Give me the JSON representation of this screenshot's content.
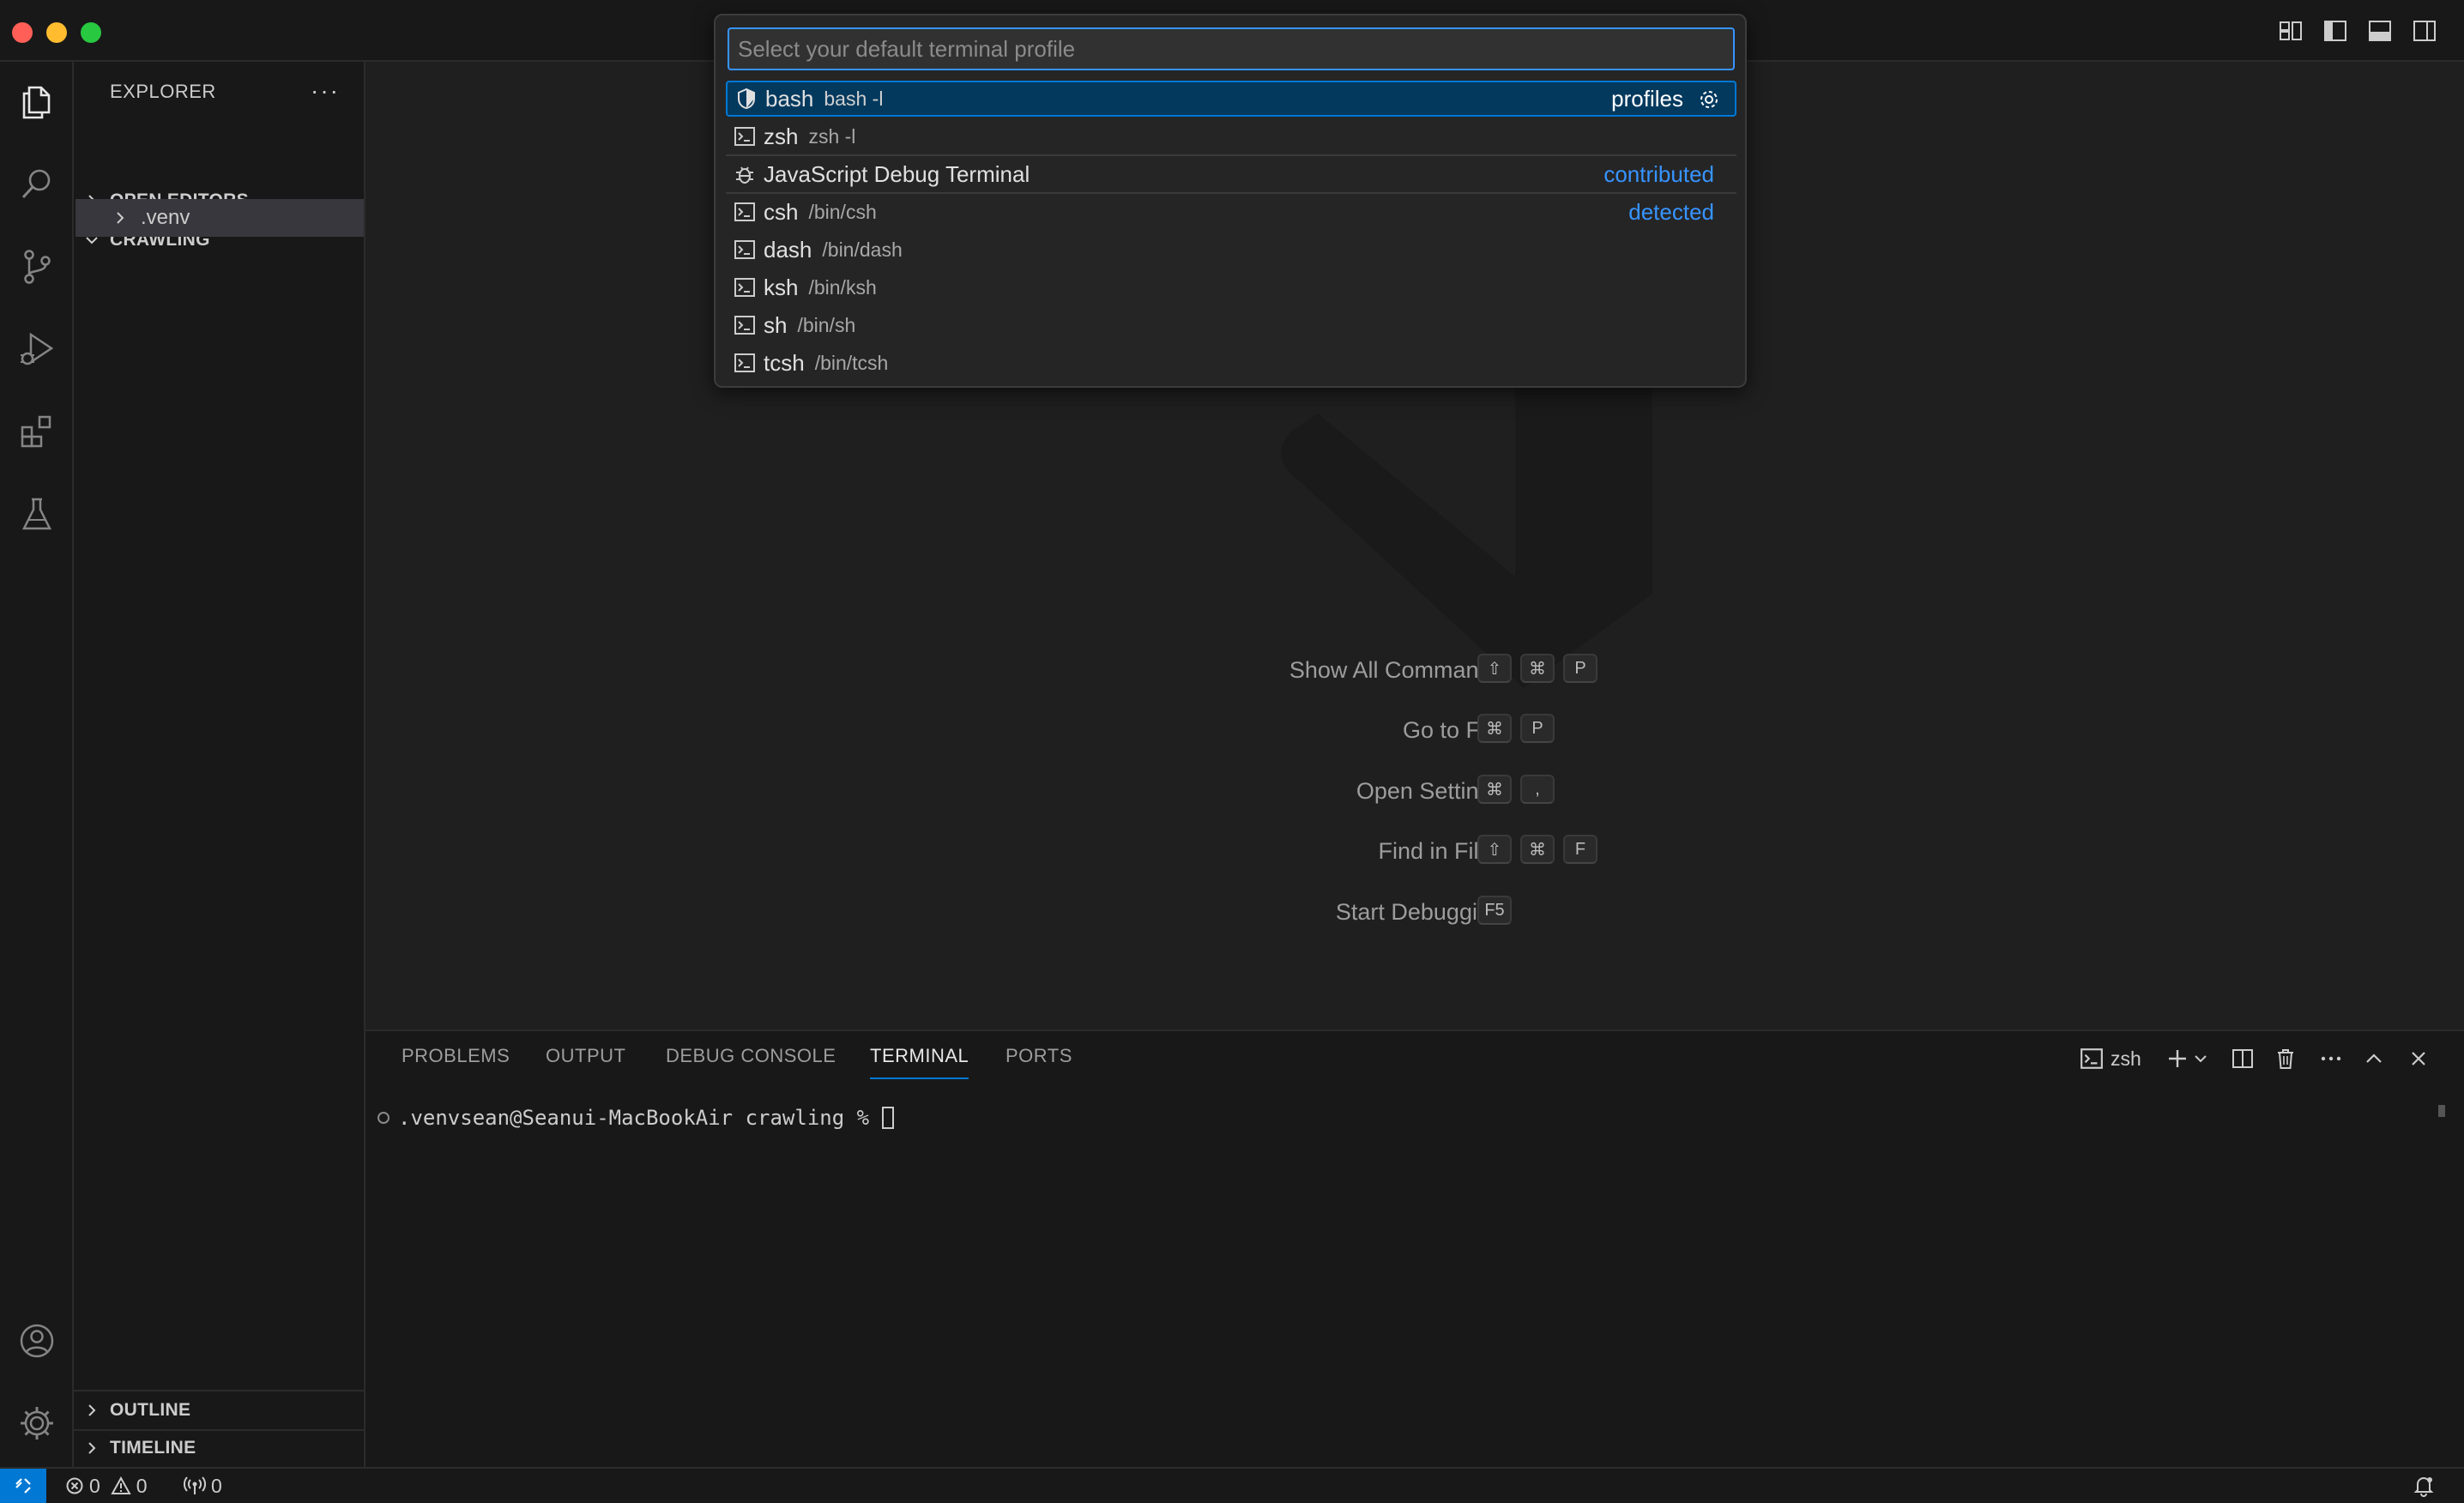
{
  "quick_pick": {
    "placeholder": "Select your default terminal profile",
    "items": [
      {
        "label": "bash",
        "description": "bash -l",
        "right": "profiles",
        "icon": "shield-icon"
      },
      {
        "label": "zsh",
        "description": "zsh -l",
        "right": "",
        "icon": "terminal-icon"
      },
      {
        "label": "JavaScript Debug Terminal",
        "description": "",
        "right": "contributed",
        "icon": "debug-icon"
      },
      {
        "label": "csh",
        "description": "/bin/csh",
        "right": "detected",
        "icon": "terminal-icon"
      },
      {
        "label": "dash",
        "description": "/bin/dash",
        "right": "",
        "icon": "terminal-icon"
      },
      {
        "label": "ksh",
        "description": "/bin/ksh",
        "right": "",
        "icon": "terminal-icon"
      },
      {
        "label": "sh",
        "description": "/bin/sh",
        "right": "",
        "icon": "terminal-icon"
      },
      {
        "label": "tcsh",
        "description": "/bin/tcsh",
        "right": "",
        "icon": "terminal-icon"
      }
    ]
  },
  "sidebar": {
    "title": "EXPLORER",
    "more": "···",
    "open_editors": "OPEN EDITORS",
    "folder": "CRAWLING",
    "venv": ".venv",
    "outline": "OUTLINE",
    "timeline": "TIMELINE"
  },
  "editor": {
    "hints": [
      {
        "label": "Show All Commands",
        "keys": [
          "⇧",
          "⌘",
          "P"
        ]
      },
      {
        "label": "Go to File",
        "keys": [
          "⌘",
          "P"
        ]
      },
      {
        "label": "Open Settings",
        "keys": [
          "⌘",
          ","
        ]
      },
      {
        "label": "Find in Files",
        "keys": [
          "⇧",
          "⌘",
          "F"
        ]
      },
      {
        "label": "Start Debugging",
        "keys": [
          "F5"
        ]
      }
    ]
  },
  "panel": {
    "tabs": [
      "PROBLEMS",
      "OUTPUT",
      "DEBUG CONSOLE",
      "TERMINAL",
      "PORTS"
    ],
    "active_tab": "TERMINAL",
    "terminal_name": "zsh",
    "prompt": ".venvsean@Seanui-MacBookAir crawling % "
  },
  "status": {
    "errors": "0",
    "warnings": "0",
    "ports": "0"
  },
  "colors": {
    "accent": "#0078d4",
    "link": "#3794ff",
    "background": "#1f1f1f",
    "sidebar": "#181818"
  }
}
